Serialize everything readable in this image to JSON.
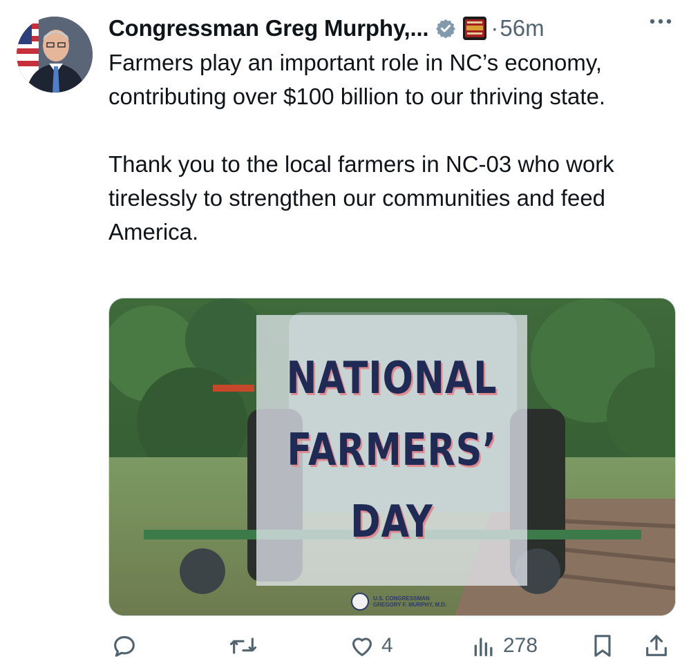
{
  "tweet": {
    "author_name": "Congressman Greg Murphy,...",
    "time_sep": "·",
    "time": "56m",
    "text": "Farmers play an important role in NC’s economy, contributing over $100 billion to our thriving state.\n\nThank you to the local farmers in NC-03 who work tirelessly to strengthen our communities and feed America."
  },
  "icons": {
    "verified": "verified-badge-icon",
    "affiliation": "affiliation-badge-icon",
    "more": "more-icon",
    "reply": "reply-icon",
    "retweet": "retweet-icon",
    "like": "like-icon",
    "views": "views-icon",
    "bookmark": "bookmark-icon",
    "share": "share-icon"
  },
  "media": {
    "lines": [
      "NATIONAL",
      "FARMERS’",
      "DAY"
    ],
    "seal_line1": "U.S. CONGRESSMAN",
    "seal_line2": "GREGORY F. MURPHY, M.D."
  },
  "actions": {
    "reply_count": "",
    "retweet_count": "",
    "like_count": "4",
    "view_count": "278"
  },
  "colors": {
    "secondary_text": "#536471",
    "verified_blue": "#829aab",
    "overlay_text": "#1f2a55",
    "overlay_shadow": "#e08a92"
  }
}
